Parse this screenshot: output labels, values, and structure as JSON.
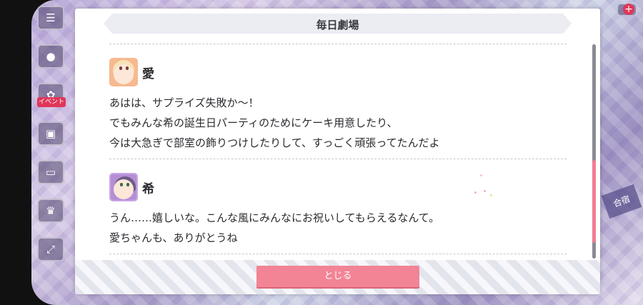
{
  "dialog": {
    "title": "毎日劇場",
    "close_label": "とじる"
  },
  "entries": [
    {
      "speaker": "愛",
      "lines": [
        "あはは、サプライズ失敗か〜！",
        "でもみんな希の誕生日パーティのためにケーキ用意したり、",
        "今は大急ぎで部室の飾りつけしたりして、すっごく頑張ってたんだよ"
      ]
    },
    {
      "speaker": "希",
      "lines": [
        "うん……嬉しいな。こんな風にみんなにお祝いしてもらえるなんて。",
        "愛ちゃんも、ありがとうね"
      ]
    }
  ],
  "background": {
    "badge_text": "イベント",
    "right_tag": "合宿"
  },
  "colors": {
    "accent": "#f28496",
    "scroll_thumb": "#f27c93"
  }
}
